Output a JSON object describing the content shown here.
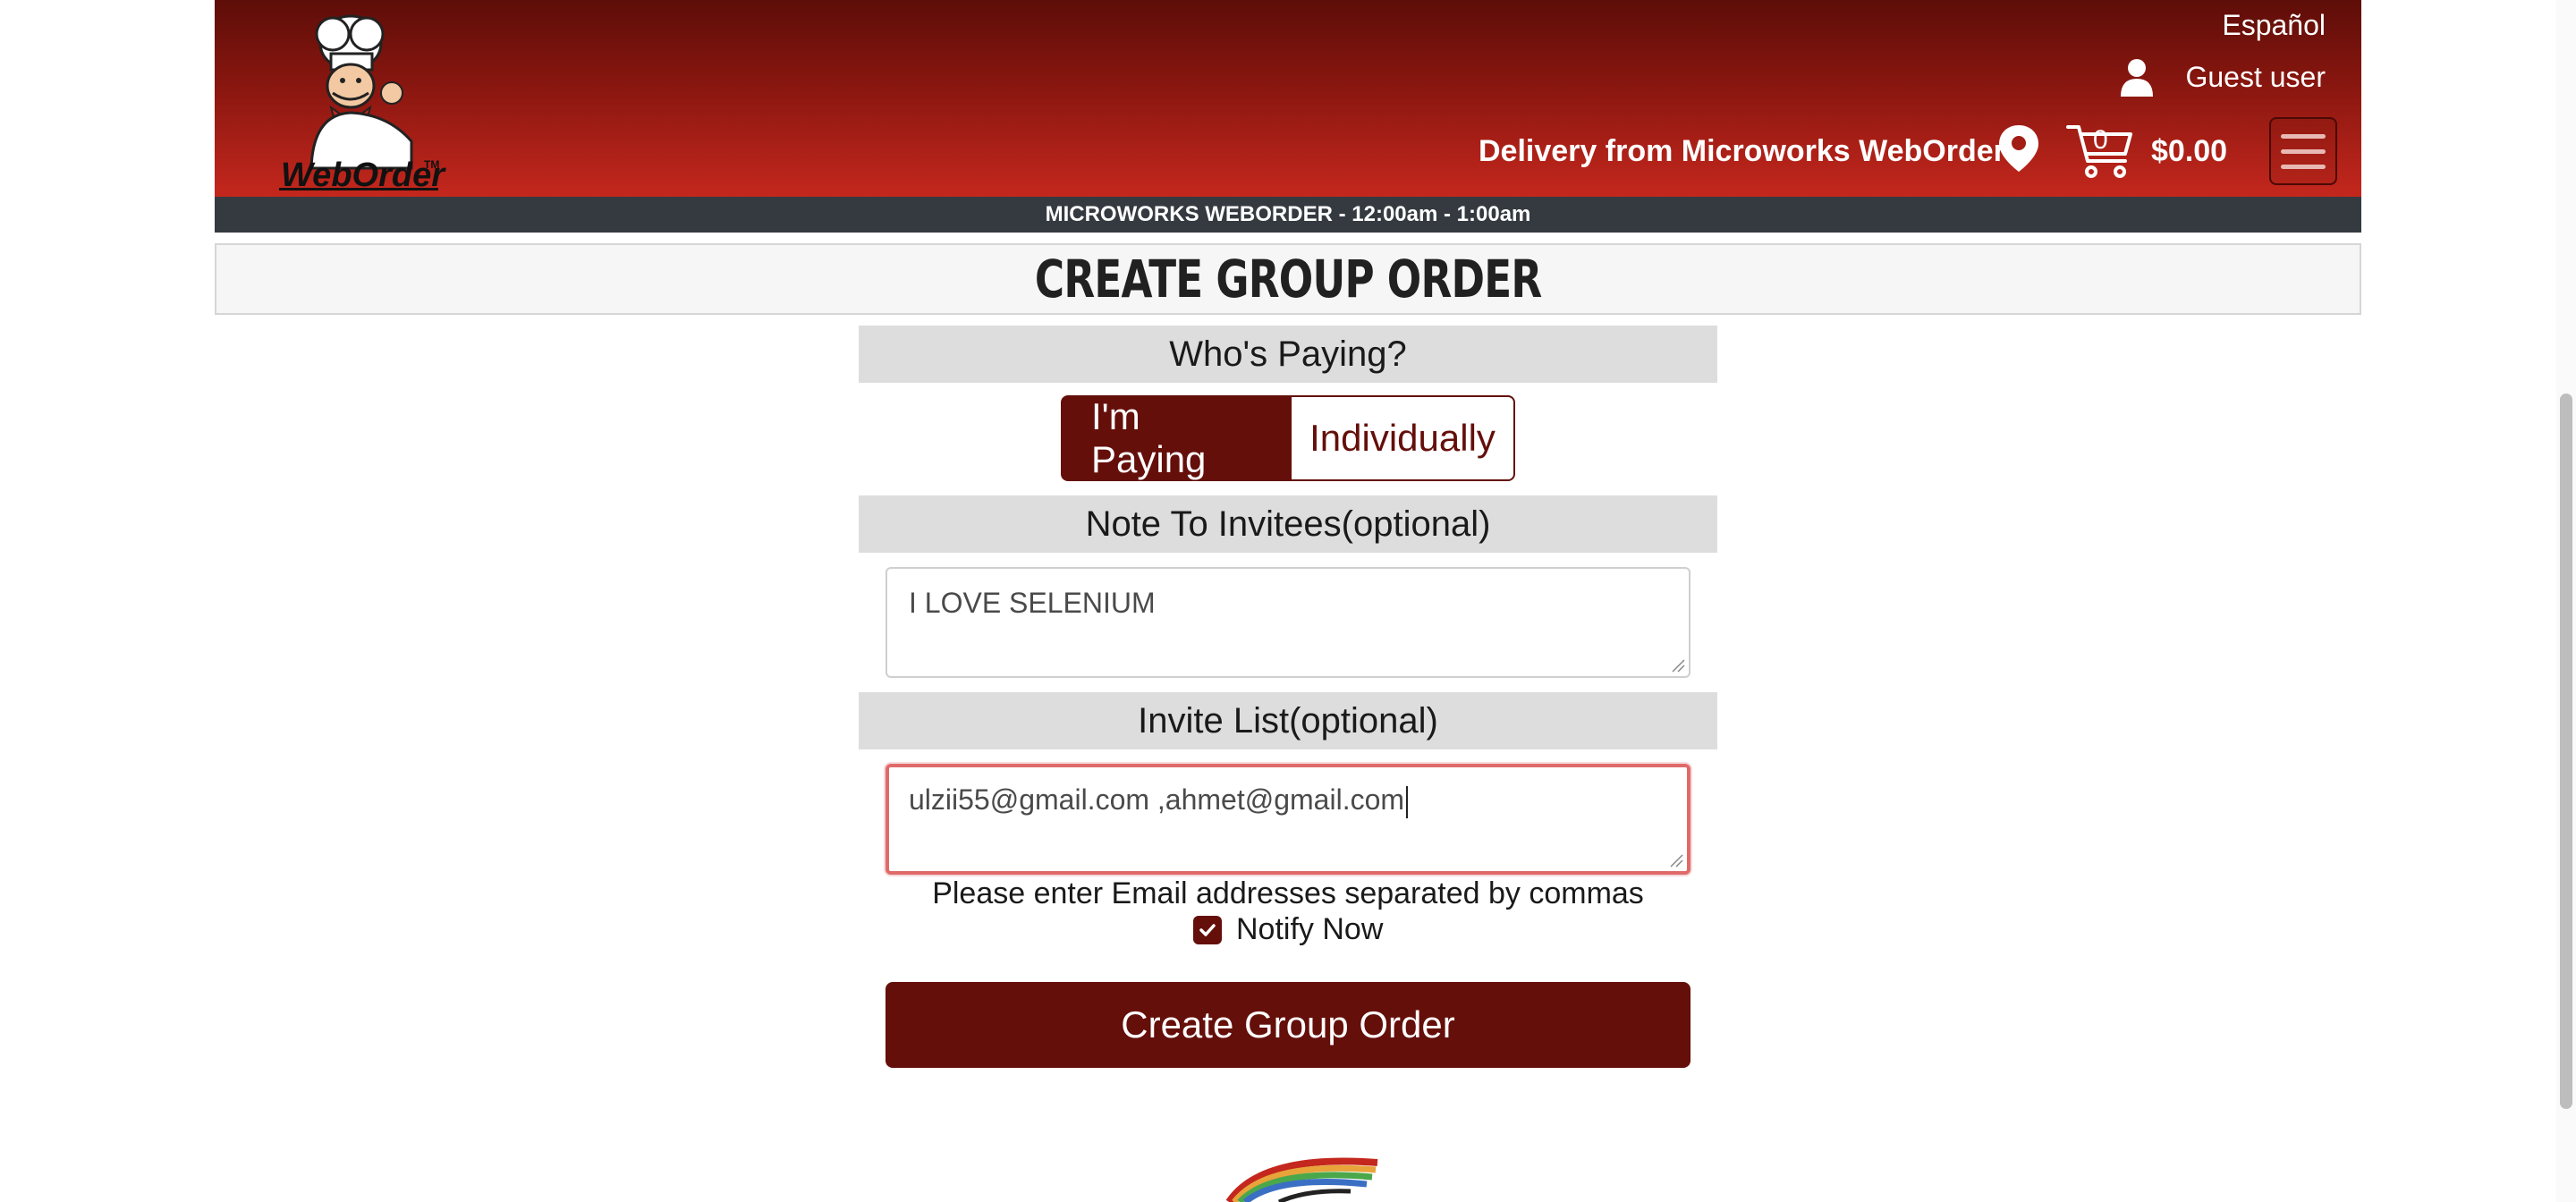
{
  "header": {
    "language_link": "Español",
    "user_label": "Guest user",
    "delivery_text": "Delivery from Microworks WebOrder",
    "cart_count": "0",
    "cart_total": "$0.00",
    "logo_text": "WebOrder™",
    "icons": [
      "chef-logo",
      "user-icon",
      "location-pin-icon",
      "cart-icon",
      "hamburger-menu-icon"
    ]
  },
  "hours_bar": "MICROWORKS WEBORDER - 12:00am - 1:00am",
  "page_title": "Create Group Order",
  "form": {
    "whos_paying_heading": "Who's Paying?",
    "pay_options": [
      "I'm Paying",
      "Individually"
    ],
    "selected_pay_option": "I'm Paying",
    "note_heading": "Note To Invitees(optional)",
    "note_value": "I LOVE SELENIUM",
    "invite_heading": "Invite List(optional)",
    "invite_value": "ulzii55@gmail.com ,ahmet@gmail.com",
    "invite_hint": "Please enter Email addresses separated by commas",
    "notify_label": "Notify Now",
    "notify_checked": true,
    "submit_label": "Create Group Order"
  },
  "colors": {
    "brand_dark_red": "#640f0a",
    "header_red": "#c4271d",
    "hours_bar": "#343a40",
    "section_gray": "#dddddd"
  }
}
